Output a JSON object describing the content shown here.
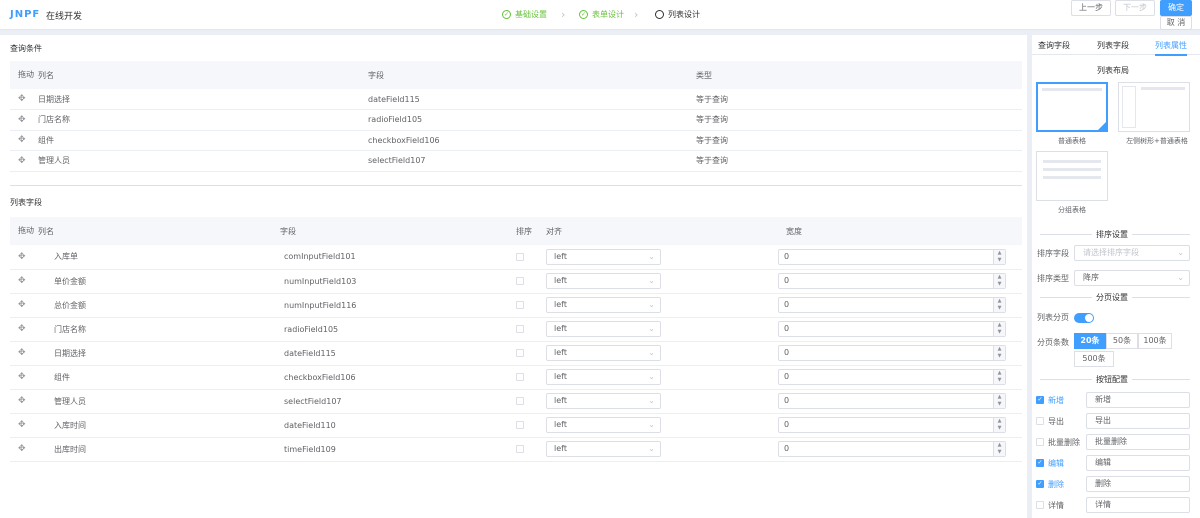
{
  "app": {
    "logo": "JNPF",
    "title": "在线开发"
  },
  "steps": [
    {
      "label": "基础设置"
    },
    {
      "label": "表单设计"
    },
    {
      "label": "列表设计"
    }
  ],
  "header": {
    "prev": "上一步",
    "next": "下一步",
    "confirm": "确定",
    "cancel": "取 消"
  },
  "query": {
    "title": "查询条件",
    "headers": [
      "拖动",
      "列名",
      "字段",
      "类型"
    ],
    "rows": [
      {
        "name": "日期选择",
        "field": "dateField115",
        "type": "等于查询"
      },
      {
        "name": "门店名称",
        "field": "radioField105",
        "type": "等于查询"
      },
      {
        "name": "组件",
        "field": "checkboxField106",
        "type": "等于查询"
      },
      {
        "name": "管理人员",
        "field": "selectField107",
        "type": "等于查询"
      }
    ]
  },
  "columns": {
    "title": "列表字段",
    "headers": [
      "拖动",
      "列名",
      "字段",
      "排序",
      "对齐",
      "宽度"
    ],
    "rows": [
      {
        "name": "入库单",
        "field": "comInputField101",
        "align": "left",
        "width": "0"
      },
      {
        "name": "单价金额",
        "field": "numInputField103",
        "align": "left",
        "width": "0"
      },
      {
        "name": "总价金额",
        "field": "numInputField116",
        "align": "left",
        "width": "0"
      },
      {
        "name": "门店名称",
        "field": "radioField105",
        "align": "left",
        "width": "0"
      },
      {
        "name": "日期选择",
        "field": "dateField115",
        "align": "left",
        "width": "0"
      },
      {
        "name": "组件",
        "field": "checkboxField106",
        "align": "left",
        "width": "0"
      },
      {
        "name": "管理人员",
        "field": "selectField107",
        "align": "left",
        "width": "0"
      },
      {
        "name": "入库时间",
        "field": "dateField110",
        "align": "left",
        "width": "0"
      },
      {
        "name": "出库时间",
        "field": "timeField109",
        "align": "left",
        "width": "0"
      }
    ]
  },
  "side": {
    "tabs": [
      "查询字段",
      "列表字段",
      "列表属性"
    ],
    "layout_title": "列表布局",
    "layouts": [
      "普通表格",
      "左侧树形+普通表格",
      "分组表格"
    ],
    "sort_title": "排序设置",
    "sort_field_label": "排序字段",
    "sort_field_placeholder": "请选择排序字段",
    "sort_type_label": "排序类型",
    "sort_type_value": "降序",
    "page_title": "分页设置",
    "page_toggle_label": "列表分页",
    "page_size_label": "分页条数",
    "page_sizes": [
      "20条",
      "50条",
      "100条",
      "500条"
    ],
    "btn_title": "按钮配置",
    "buttons": [
      {
        "label": "新增",
        "value": "新增",
        "checked": true
      },
      {
        "label": "导出",
        "value": "导出",
        "checked": false
      },
      {
        "label": "批量删除",
        "value": "批量删除",
        "checked": false
      },
      {
        "label": "编辑",
        "value": "编辑",
        "checked": true
      },
      {
        "label": "删除",
        "value": "删除",
        "checked": true
      },
      {
        "label": "详情",
        "value": "详情",
        "checked": false
      }
    ]
  },
  "colors": {
    "primary": "#409eff",
    "success": "#67c23a"
  }
}
